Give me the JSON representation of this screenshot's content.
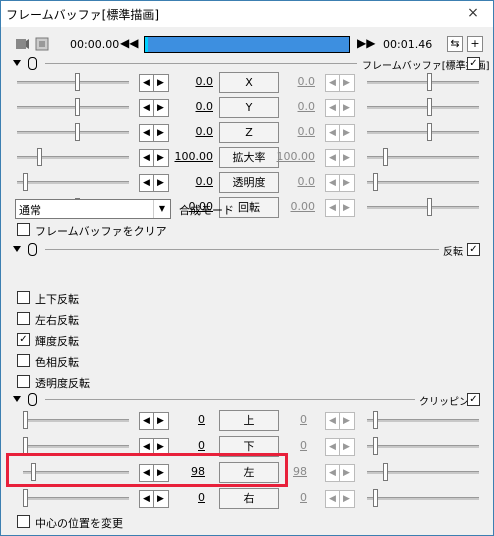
{
  "window": {
    "title": "フレームバッファ[標準描画]",
    "close": "×"
  },
  "toolbar": {
    "time_start": "00:00.00",
    "time_end": "00:01.46",
    "prev": "◀◀",
    "next": "▶▶",
    "btn1": "⇆",
    "btn2": "+"
  },
  "sections": {
    "main": {
      "title": "フレームバッファ[標準描画]",
      "checked": "✓"
    },
    "flip": {
      "title": "反転",
      "checked": "✓"
    },
    "clip": {
      "title": "クリッピング",
      "checked": "✓"
    }
  },
  "params": [
    {
      "name": "X",
      "left": "0.0",
      "right": "0.0"
    },
    {
      "name": "Y",
      "left": "0.0",
      "right": "0.0"
    },
    {
      "name": "Z",
      "left": "0.0",
      "right": "0.0"
    },
    {
      "name": "拡大率",
      "left": "100.00",
      "right": "100.00"
    },
    {
      "name": "透明度",
      "left": "0.0",
      "right": "0.0"
    },
    {
      "name": "回転",
      "left": "0.00",
      "right": "0.00"
    }
  ],
  "blend": {
    "value": "通常",
    "label": "合成モード"
  },
  "clear_buffer": {
    "label": "フレームバッファをクリア",
    "checked": ""
  },
  "flips": [
    {
      "label": "上下反転",
      "checked": ""
    },
    {
      "label": "左右反転",
      "checked": ""
    },
    {
      "label": "輝度反転",
      "checked": "✓"
    },
    {
      "label": "色相反転",
      "checked": ""
    },
    {
      "label": "透明度反転",
      "checked": ""
    }
  ],
  "clips": [
    {
      "name": "上",
      "left": "0",
      "right": "0"
    },
    {
      "name": "下",
      "left": "0",
      "right": "0"
    },
    {
      "name": "左",
      "left": "98",
      "right": "98"
    },
    {
      "name": "右",
      "left": "0",
      "right": "0"
    }
  ],
  "center_change": {
    "label": "中心の位置を変更",
    "checked": ""
  },
  "arrow_left": "◀",
  "arrow_right": "▶",
  "dropdown": "▼"
}
